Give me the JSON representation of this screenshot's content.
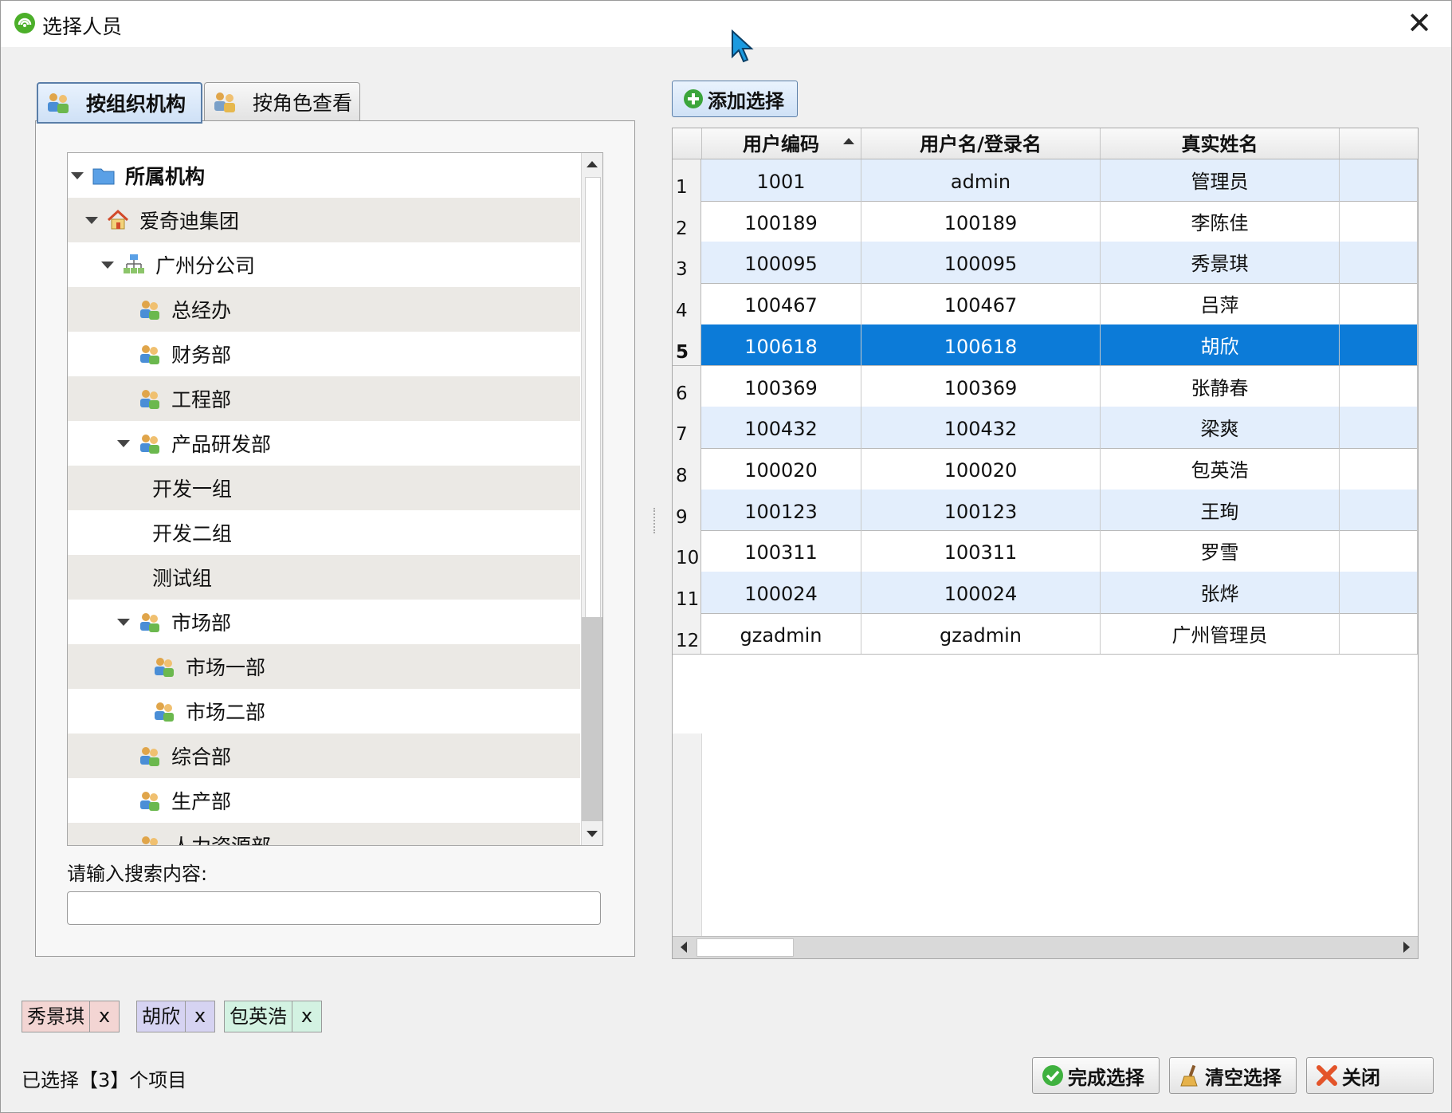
{
  "window": {
    "title": "选择人员",
    "close_glyph": "✕"
  },
  "tabs": [
    {
      "label": "按组织机构",
      "active": true
    },
    {
      "label": "按角色查看",
      "active": false
    }
  ],
  "tree": {
    "nodes": [
      {
        "label": "所属机构",
        "level": 0,
        "expanded": true,
        "icon": "folder-icon"
      },
      {
        "label": "爱奇迪集团",
        "level": 1,
        "expanded": true,
        "icon": "home-icon"
      },
      {
        "label": "广州分公司",
        "level": 2,
        "expanded": true,
        "icon": "org-chart-icon"
      },
      {
        "label": "总经办",
        "level": 3,
        "icon": "group-icon"
      },
      {
        "label": "财务部",
        "level": 3,
        "icon": "group-icon"
      },
      {
        "label": "工程部",
        "level": 3,
        "icon": "group-icon"
      },
      {
        "label": "产品研发部",
        "level": 3,
        "expanded": true,
        "icon": "group-icon"
      },
      {
        "label": "开发一组",
        "level": 4,
        "icon": ""
      },
      {
        "label": "开发二组",
        "level": 4,
        "icon": ""
      },
      {
        "label": "测试组",
        "level": 4,
        "icon": ""
      },
      {
        "label": "市场部",
        "level": 3,
        "expanded": true,
        "icon": "group-icon"
      },
      {
        "label": "市场一部",
        "level": 4,
        "icon": "group-icon"
      },
      {
        "label": "市场二部",
        "level": 4,
        "icon": "group-icon"
      },
      {
        "label": "综合部",
        "level": 3,
        "icon": "group-icon"
      },
      {
        "label": "生产部",
        "level": 3,
        "icon": "group-icon"
      },
      {
        "label": "人力资源部",
        "level": 3,
        "icon": "group-icon"
      }
    ]
  },
  "search": {
    "label": "请输入搜索内容:",
    "value": "",
    "placeholder": ""
  },
  "toolbar": {
    "add_label": "添加选择"
  },
  "grid": {
    "columns": [
      "用户编码",
      "用户名/登录名",
      "真实姓名"
    ],
    "sorted_column": "用户编码",
    "selected_row": 5,
    "rows": [
      {
        "num": "1",
        "code": "1001",
        "login": "admin",
        "name": "管理员"
      },
      {
        "num": "2",
        "code": "100189",
        "login": "100189",
        "name": "李陈佳"
      },
      {
        "num": "3",
        "code": "100095",
        "login": "100095",
        "name": "秀景琪"
      },
      {
        "num": "4",
        "code": "100467",
        "login": "100467",
        "name": "吕萍"
      },
      {
        "num": "5",
        "code": "100618",
        "login": "100618",
        "name": "胡欣"
      },
      {
        "num": "6",
        "code": "100369",
        "login": "100369",
        "name": "张静春"
      },
      {
        "num": "7",
        "code": "100432",
        "login": "100432",
        "name": "梁爽"
      },
      {
        "num": "8",
        "code": "100020",
        "login": "100020",
        "name": "包英浩"
      },
      {
        "num": "9",
        "code": "100123",
        "login": "100123",
        "name": "王珣"
      },
      {
        "num": "10",
        "code": "100311",
        "login": "100311",
        "name": "罗雪"
      },
      {
        "num": "11",
        "code": "100024",
        "login": "100024",
        "name": "张烨"
      },
      {
        "num": "12",
        "code": "gzadmin",
        "login": "gzadmin",
        "name": "广州管理员"
      }
    ]
  },
  "selected_tags": [
    {
      "name": "秀景琪",
      "remove": "x",
      "color": "#f3d5d3"
    },
    {
      "name": "胡欣",
      "remove": "x",
      "color": "#d6d3f2"
    },
    {
      "name": "包英浩",
      "remove": "x",
      "color": "#d3f2e2"
    }
  ],
  "status": {
    "text": "已选择【3】个项目"
  },
  "buttons": {
    "finish": "完成选择",
    "clear": "清空选择",
    "close": "关闭"
  },
  "colors": {
    "selected_row": "#0c7bd8",
    "alt_row": "#e3eefc",
    "tree_alt_row": "#ebe9e5"
  }
}
